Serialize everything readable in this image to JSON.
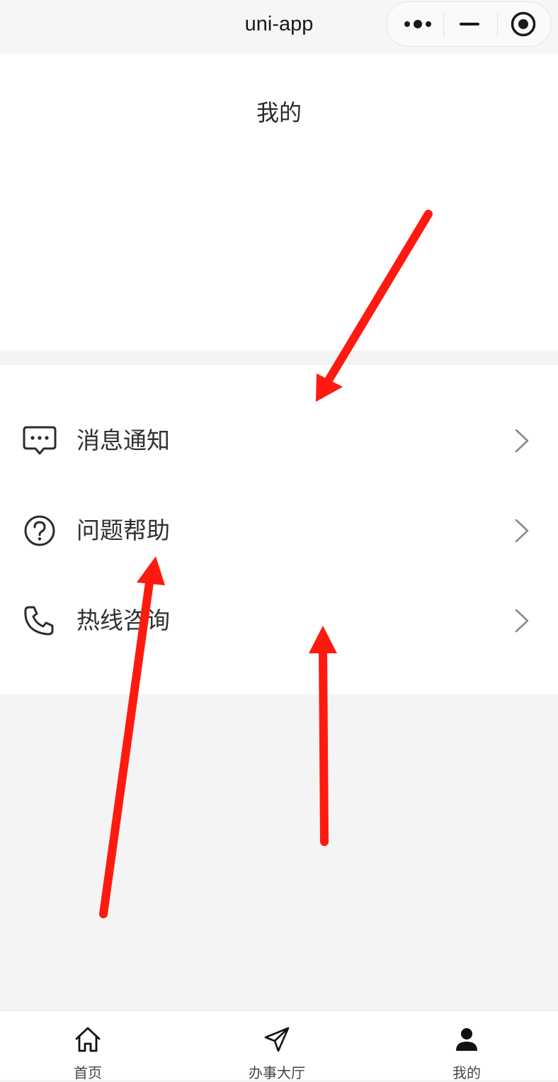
{
  "nav_bar": {
    "title": "uni-app",
    "capsule_icons": [
      "more-dots-icon",
      "minimize-icon",
      "close-target-icon"
    ]
  },
  "header": {
    "title": "我的"
  },
  "menu": {
    "items": [
      {
        "label": "消息通知",
        "icon": "message-bubble-icon"
      },
      {
        "label": "问题帮助",
        "icon": "question-circle-icon"
      },
      {
        "label": "热线咨询",
        "icon": "phone-icon"
      }
    ]
  },
  "tab_bar": {
    "items": [
      {
        "label": "首页",
        "icon": "home-icon",
        "active": false
      },
      {
        "label": "办事大厅",
        "icon": "send-icon",
        "active": false
      },
      {
        "label": "我的",
        "icon": "user-icon",
        "active": true
      }
    ]
  },
  "annotation": {
    "arrow_color": "#ff1a0f"
  }
}
